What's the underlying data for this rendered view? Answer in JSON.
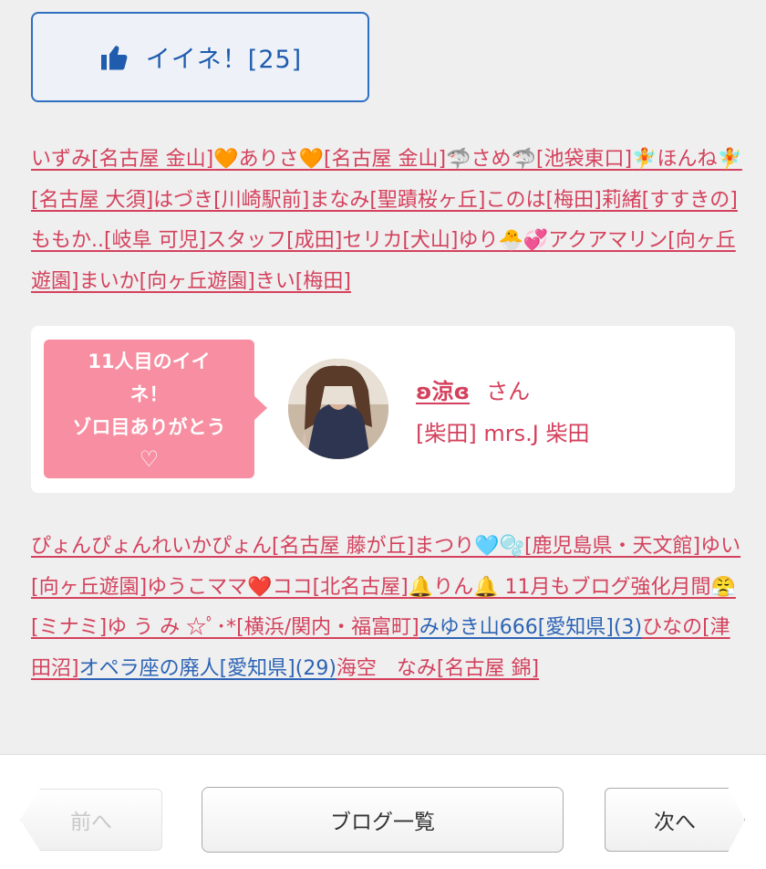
{
  "like": {
    "label": "イイネ！[25]",
    "icon": "thumbs-up-icon"
  },
  "likers_top": [
    {
      "text": "いずみ[名古屋 金山]",
      "color": "pink"
    },
    {
      "text": "🧡ありさ🧡[名古屋 金山]",
      "color": "pink"
    },
    {
      "text": "🦈さめ🦈[池袋東口]",
      "color": "pink"
    },
    {
      "text": "🧚ほんね🧚[名古屋 大須]",
      "color": "pink"
    },
    {
      "text": "はづき[川崎駅前]",
      "color": "pink"
    },
    {
      "text": "まなみ[聖蹟桜ヶ丘]",
      "color": "pink"
    },
    {
      "text": "このは[梅田]",
      "color": "pink"
    },
    {
      "text": "莉緒[すすきの]",
      "color": "pink"
    },
    {
      "text": "ももか..[岐阜 可児]",
      "color": "pink"
    },
    {
      "text": "スタッフ[成田]",
      "color": "pink"
    },
    {
      "text": "セリカ[犬山]",
      "color": "pink"
    },
    {
      "text": "ゆり🐣💞",
      "color": "pink"
    },
    {
      "text": "アクアマリン[向ヶ丘遊園]",
      "color": "pink"
    },
    {
      "text": "まいか[向ヶ丘遊園]",
      "color": "pink"
    },
    {
      "text": "きい[梅田]",
      "color": "pink"
    }
  ],
  "card": {
    "bubble_line1": "11人目のイイ",
    "bubble_line2": "ネ！",
    "bubble_line3": "ゾロ目ありがとう",
    "bubble_heart": "♡",
    "name": "ʚ涼ɞ",
    "suffix": "さん",
    "store": "[柴田] mrs.J 柴田"
  },
  "likers_bottom": [
    {
      "text": "ぴょんぴょんれいかぴょん[名古屋 藤が丘]",
      "color": "pink"
    },
    {
      "text": "まつり🩵🫧[鹿児島県・天文館]",
      "color": "pink"
    },
    {
      "text": "ゆい[向ヶ丘遊園]",
      "color": "pink"
    },
    {
      "text": "ゆうこママ❤️ココ[北名古屋]",
      "color": "pink"
    },
    {
      "text": "🔔りん🔔 11月もブログ強化月間😤[ミナミ]",
      "color": "pink"
    },
    {
      "text": "ゆ う み ☆ﾟ･*[横浜/関内・福富町]",
      "color": "pink"
    },
    {
      "text": "みゆき山666[愛知県](3)",
      "color": "blue"
    },
    {
      "text": "ひなの[津田沼]",
      "color": "pink"
    },
    {
      "text": "オペラ座の廃人[愛知県](29)",
      "color": "blue"
    },
    {
      "text": "海空　なみ[名古屋 錦]",
      "color": "pink"
    }
  ],
  "footer": {
    "prev": "前へ",
    "list": "ブログ一覧",
    "next": "次へ"
  }
}
